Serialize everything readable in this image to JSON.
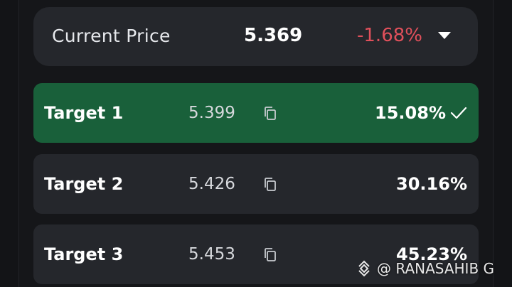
{
  "current": {
    "label": "Current Price",
    "value": "5.369",
    "change": "-1.68%"
  },
  "targets": [
    {
      "label": "Target 1",
      "value": "5.399",
      "percent": "15.08%",
      "reached": true
    },
    {
      "label": "Target 2",
      "value": "5.426",
      "percent": "30.16%",
      "reached": false
    },
    {
      "label": "Target 3",
      "value": "5.453",
      "percent": "45.23%",
      "reached": false
    }
  ],
  "watermark": {
    "text": "@ RANASAHIB G",
    "icon": "binance-logo-icon"
  },
  "colors": {
    "negative": "#e0505b",
    "reached": "#19603a",
    "card": "#25272c"
  }
}
